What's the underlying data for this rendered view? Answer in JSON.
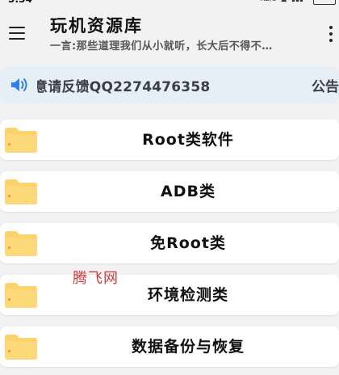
{
  "app_bar": {
    "title": "玩机资源库",
    "subtitle": "一言:那些道理我们从小就听，长大后不得不…",
    "menu_icon": "hamburger-menu-icon",
    "more_icon": "more-vertical-icon"
  },
  "notice": {
    "icon": "speaker-icon",
    "text": "意请反馈QQ2274476358",
    "tail": "公告"
  },
  "categories": [
    {
      "label": "Root类软件",
      "icon": "folder-icon"
    },
    {
      "label": "ADB类",
      "icon": "folder-icon"
    },
    {
      "label": "免Root类",
      "icon": "folder-icon"
    },
    {
      "label": "环境检测类",
      "icon": "folder-icon"
    },
    {
      "label": "数据备份与恢复",
      "icon": "folder-icon"
    }
  ],
  "watermark": "腾飞网",
  "colors": {
    "background": "#f2f2f2",
    "card": "#ffffff",
    "notice_bg": "#e6eef6",
    "accent_blue": "#2f80ed",
    "folder": "#fbd36b",
    "watermark": "#d83a3a"
  }
}
